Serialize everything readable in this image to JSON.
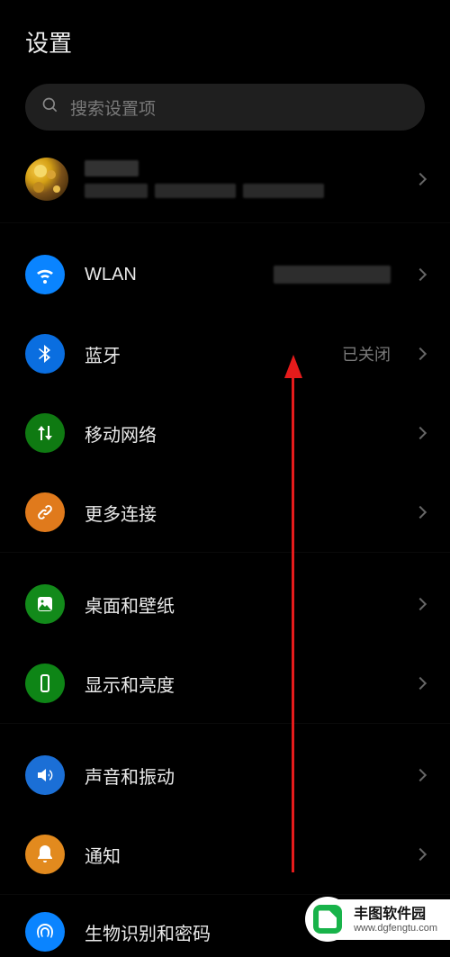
{
  "page": {
    "title": "设置"
  },
  "search": {
    "placeholder": "搜索设置项"
  },
  "groups": [
    {
      "items": [
        {
          "id": "wlan",
          "label": "WLAN",
          "value_hidden": true,
          "icon": "wifi",
          "color": "ic-blue"
        },
        {
          "id": "bluetooth",
          "label": "蓝牙",
          "value": "已关闭",
          "icon": "bluetooth",
          "color": "ic-blue2"
        },
        {
          "id": "mobile",
          "label": "移动网络",
          "icon": "updown",
          "color": "ic-green-dark"
        },
        {
          "id": "more_conn",
          "label": "更多连接",
          "icon": "link",
          "color": "ic-orange"
        }
      ]
    },
    {
      "items": [
        {
          "id": "desktop",
          "label": "桌面和壁纸",
          "icon": "image",
          "color": "ic-green"
        },
        {
          "id": "display",
          "label": "显示和亮度",
          "icon": "phone",
          "color": "ic-green-light"
        }
      ]
    },
    {
      "items": [
        {
          "id": "sound",
          "label": "声音和振动",
          "icon": "sound",
          "color": "ic-blue3"
        },
        {
          "id": "notify",
          "label": "通知",
          "icon": "bell",
          "color": "ic-orange2"
        }
      ]
    }
  ],
  "partial": {
    "label": "生物识别和密码",
    "icon": "fingerprint",
    "color": "ic-blue"
  },
  "watermark": {
    "title": "丰图软件园",
    "url": "www.dgfengtu.com"
  },
  "colors": {
    "blue": "#0a84ff",
    "green": "#128a1a",
    "orange": "#e07a1c",
    "text_muted": "#7a7a7a"
  }
}
